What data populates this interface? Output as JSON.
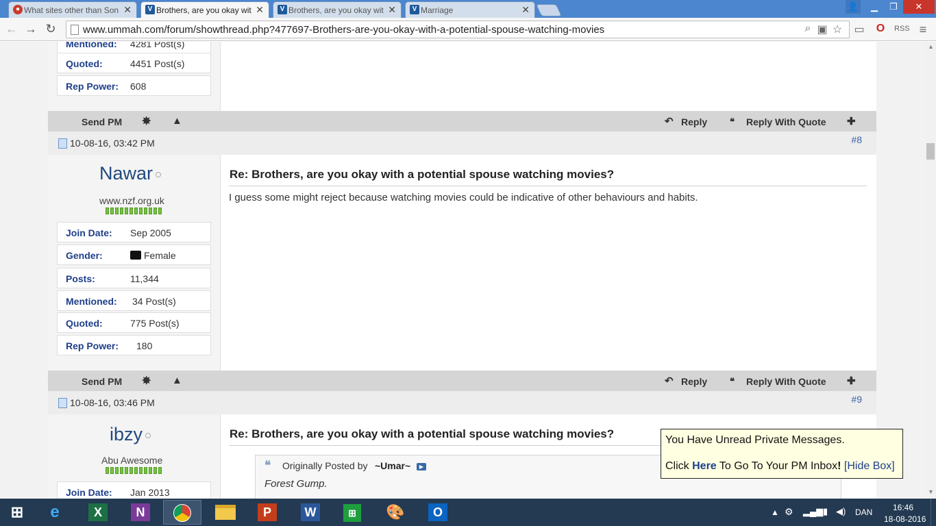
{
  "browser": {
    "tabs": [
      {
        "title": "What sites other than Son",
        "active": false
      },
      {
        "title": "Brothers, are you okay wit",
        "active": true
      },
      {
        "title": "Brothers, are you okay wit",
        "active": false
      },
      {
        "title": "Marriage",
        "active": false
      }
    ],
    "url": "www.ummah.com/forum/showthread.php?477697-Brothers-are-you-okay-with-a-potential-spouse-watching-movies"
  },
  "prev_post": {
    "mentioned_label": "Mentioned:",
    "mentioned_value": "4281 Post(s)",
    "quoted_label": "Quoted:",
    "quoted_value": "4451 Post(s)",
    "rep_label": "Rep Power:",
    "rep_value": "608"
  },
  "actions": {
    "send_pm": "Send PM",
    "reply": "Reply",
    "reply_with_quote": "Reply With Quote"
  },
  "post8": {
    "date": "10-08-16, 03:42 PM",
    "number": "#8",
    "username": "Nawar",
    "user_title": "www.nzf.org.uk",
    "rep_pips": 12,
    "info": {
      "join_label": "Join Date:",
      "join_value": "Sep 2005",
      "gender_label": "Gender:",
      "gender_value": "Female",
      "posts_label": "Posts:",
      "posts_value": "11,344",
      "mentioned_label": "Mentioned:",
      "mentioned_value": "34 Post(s)",
      "quoted_label": "Quoted:",
      "quoted_value": "775 Post(s)",
      "rep_label": "Rep Power:",
      "rep_value": "180"
    },
    "title": "Re: Brothers, are you okay with a potential spouse watching movies?",
    "body": "I guess some might reject because watching movies could be indicative of other behaviours and habits."
  },
  "post9": {
    "date": "10-08-16, 03:46 PM",
    "number": "#9",
    "username": "ibzy",
    "user_title": "Abu Awesome",
    "rep_pips": 12,
    "info": {
      "join_label": "Join Date:",
      "join_value": "Jan 2013"
    },
    "title": "Re: Brothers, are you okay with a potential spouse watching movies?",
    "quote_prefix": "Originally Posted by",
    "quote_author": "~Umar~",
    "quote_text": "Forest Gump."
  },
  "pm_popup": {
    "line1": "You Have Unread Private Messages.",
    "line2_a": "Click",
    "line2_here": "Here",
    "line2_b": "To Go To Your PM Inbox",
    "line2_excl": "!",
    "hide": "[Hide Box]"
  },
  "taskbar": {
    "apps": [
      "start-button",
      "internet-explorer",
      "excel",
      "onenote",
      "chrome",
      "file-explorer",
      "powerpoint",
      "word",
      "store",
      "paint",
      "outlook"
    ],
    "language": "DAN",
    "time": "16:46",
    "date": "18-08-2016"
  }
}
